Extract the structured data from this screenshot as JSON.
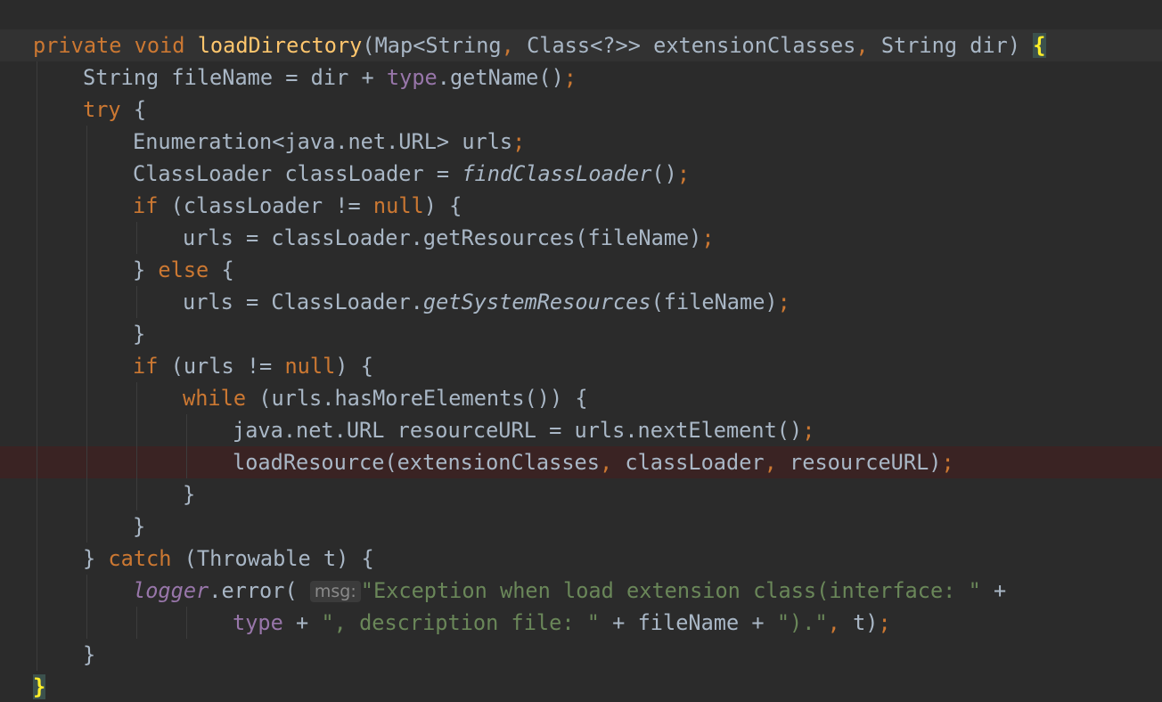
{
  "editor": {
    "colors": {
      "background": "#2b2b2b",
      "current_line": "#323232",
      "breakpoint_line": "#3a2323",
      "default_text": "#a9b7c6",
      "keyword": "#cc7832",
      "method_declaration": "#ffc66d",
      "field": "#9876aa",
      "string": "#6a8759",
      "matched_brace": "#ffef28",
      "param_hint": "#8a8a8a"
    },
    "lines": [
      {
        "indent": 0,
        "style": "hl",
        "tokens": [
          {
            "t": "private",
            "c": "keyword"
          },
          {
            "t": " "
          },
          {
            "t": "void",
            "c": "keyword"
          },
          {
            "t": " "
          },
          {
            "t": "loadDirectory",
            "c": "method_declaration"
          },
          {
            "t": "(Map<String"
          },
          {
            "t": ",",
            "c": "keyword"
          },
          {
            "t": " Class<?>> extensionClasses"
          },
          {
            "t": ",",
            "c": "keyword"
          },
          {
            "t": " String dir) "
          },
          {
            "t": "{",
            "c": "matched_brace",
            "m": "brace"
          }
        ]
      },
      {
        "indent": 1,
        "tokens": [
          {
            "t": "String fileName = dir + "
          },
          {
            "t": "type",
            "c": "field"
          },
          {
            "t": ".getName()"
          },
          {
            "t": ";",
            "c": "keyword"
          }
        ]
      },
      {
        "indent": 1,
        "tokens": [
          {
            "t": "try",
            "c": "keyword"
          },
          {
            "t": " {"
          }
        ]
      },
      {
        "indent": 2,
        "tokens": [
          {
            "t": "Enumeration<java.net.URL> urls"
          },
          {
            "t": ";",
            "c": "keyword"
          }
        ]
      },
      {
        "indent": 2,
        "tokens": [
          {
            "t": "ClassLoader classLoader = "
          },
          {
            "t": "findClassLoader",
            "m": "italic"
          },
          {
            "t": "()"
          },
          {
            "t": ";",
            "c": "keyword"
          }
        ]
      },
      {
        "indent": 2,
        "tokens": [
          {
            "t": "if",
            "c": "keyword"
          },
          {
            "t": " (classLoader != "
          },
          {
            "t": "null",
            "c": "keyword"
          },
          {
            "t": ") {"
          }
        ]
      },
      {
        "indent": 3,
        "tokens": [
          {
            "t": "urls = classLoader.getResources(fileName)"
          },
          {
            "t": ";",
            "c": "keyword"
          }
        ]
      },
      {
        "indent": 2,
        "tokens": [
          {
            "t": "} "
          },
          {
            "t": "else",
            "c": "keyword"
          },
          {
            "t": " {"
          }
        ]
      },
      {
        "indent": 3,
        "tokens": [
          {
            "t": "urls = ClassLoader."
          },
          {
            "t": "getSystemResources",
            "m": "italic"
          },
          {
            "t": "(fileName)"
          },
          {
            "t": ";",
            "c": "keyword"
          }
        ]
      },
      {
        "indent": 2,
        "tokens": [
          {
            "t": "}"
          }
        ]
      },
      {
        "indent": 2,
        "tokens": [
          {
            "t": "if",
            "c": "keyword"
          },
          {
            "t": " (urls != "
          },
          {
            "t": "null",
            "c": "keyword"
          },
          {
            "t": ") {"
          }
        ]
      },
      {
        "indent": 3,
        "tokens": [
          {
            "t": "while",
            "c": "keyword"
          },
          {
            "t": " (urls.hasMoreElements()) {"
          }
        ]
      },
      {
        "indent": 4,
        "tokens": [
          {
            "t": "java.net.URL resourceURL = urls.nextElement()"
          },
          {
            "t": ";",
            "c": "keyword"
          }
        ]
      },
      {
        "indent": 4,
        "style": "bp",
        "tokens": [
          {
            "t": "loadResource(extensionClasses"
          },
          {
            "t": ",",
            "c": "keyword"
          },
          {
            "t": " classLoader"
          },
          {
            "t": ",",
            "c": "keyword"
          },
          {
            "t": " resourceURL)"
          },
          {
            "t": ";",
            "c": "keyword"
          }
        ]
      },
      {
        "indent": 3,
        "tokens": [
          {
            "t": "}"
          }
        ]
      },
      {
        "indent": 2,
        "tokens": [
          {
            "t": "}"
          }
        ]
      },
      {
        "indent": 1,
        "tokens": [
          {
            "t": "} "
          },
          {
            "t": "catch",
            "c": "keyword"
          },
          {
            "t": " (Throwable t) {"
          }
        ]
      },
      {
        "indent": 2,
        "tokens": [
          {
            "t": "logger",
            "c": "field",
            "m": "italic"
          },
          {
            "t": ".error( "
          },
          {
            "t": "msg:",
            "m": "hint"
          },
          {
            "t": "\"Exception when load extension class(interface: \"",
            "c": "string"
          },
          {
            "t": " +"
          }
        ]
      },
      {
        "indent": 4,
        "tokens": [
          {
            "t": "type",
            "c": "field"
          },
          {
            "t": " + "
          },
          {
            "t": "\", description file: \"",
            "c": "string"
          },
          {
            "t": " + fileName + "
          },
          {
            "t": "\").\"",
            "c": "string"
          },
          {
            "t": ",",
            "c": "keyword"
          },
          {
            "t": " t)"
          },
          {
            "t": ";",
            "c": "keyword"
          }
        ]
      },
      {
        "indent": 1,
        "tokens": [
          {
            "t": "}"
          }
        ]
      },
      {
        "indent": 0,
        "tokens": [
          {
            "t": "}",
            "c": "matched_brace",
            "m": "brace"
          }
        ]
      }
    ]
  }
}
